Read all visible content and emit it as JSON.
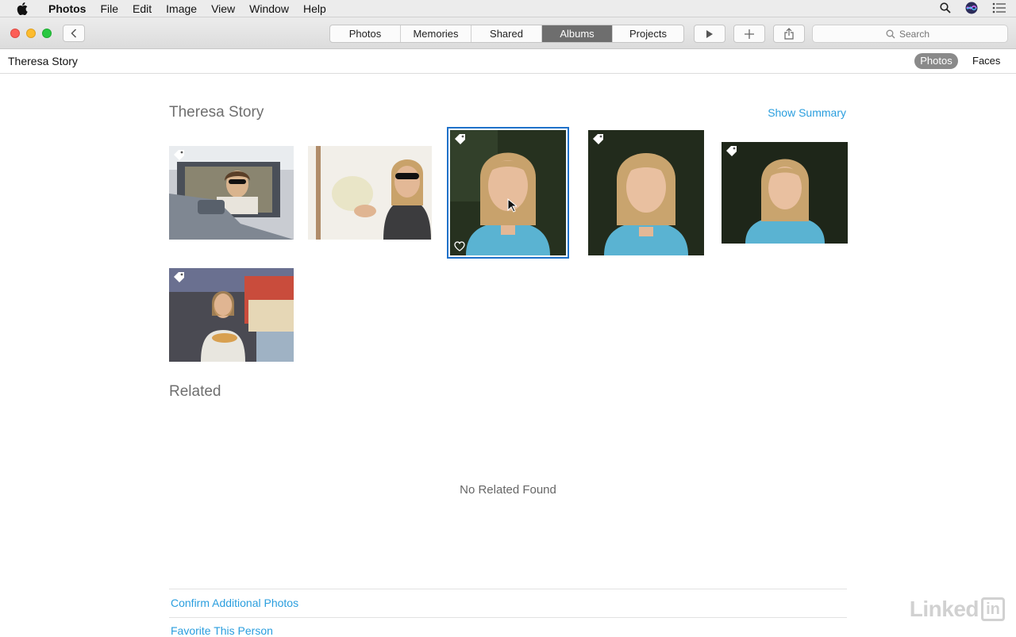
{
  "menubar": {
    "app_name": "Photos",
    "items": [
      "File",
      "Edit",
      "Image",
      "View",
      "Window",
      "Help"
    ]
  },
  "toolbar": {
    "tabs": [
      {
        "label": "Photos"
      },
      {
        "label": "Memories"
      },
      {
        "label": "Shared"
      },
      {
        "label": "Albums",
        "active": true
      },
      {
        "label": "Projects"
      }
    ],
    "search": {
      "placeholder": "Search"
    }
  },
  "subheader": {
    "person_name": "Theresa Story",
    "view_tabs": {
      "photos": "Photos",
      "faces": "Faces"
    }
  },
  "main": {
    "title": "Theresa Story",
    "show_summary": "Show Summary",
    "related_title": "Related",
    "no_related": "No Related Found",
    "actions": {
      "confirm": "Confirm Additional Photos",
      "favorite": "Favorite This Person"
    }
  },
  "watermark": {
    "text": "Linked",
    "box": "in"
  },
  "colors": {
    "accent": "#2a9ede",
    "selection": "#1f71c9",
    "active_tab": "#6e6e6e"
  }
}
